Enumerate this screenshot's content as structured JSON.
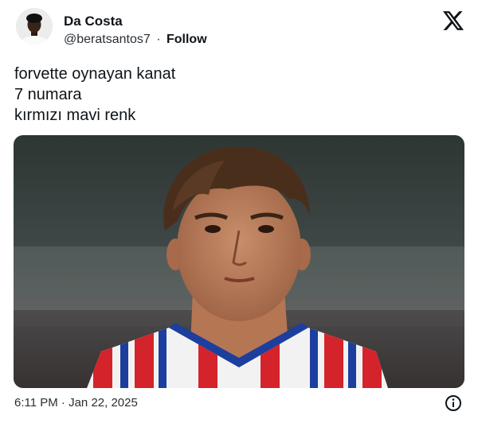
{
  "author": {
    "name": "Da Costa",
    "handle": "@beratsantos7",
    "separator": "·",
    "follow_label": "Follow"
  },
  "tweet": {
    "lines": [
      "forvette oynayan kanat",
      "7 numara",
      "kırmızı mavi renk"
    ]
  },
  "footer": {
    "time": "6:11 PM",
    "separator": "·",
    "date": "Jan 22, 2025"
  },
  "icons": {
    "brand": "x-logo-icon",
    "info": "info-icon"
  },
  "colors": {
    "text": "#0f1419",
    "secondary": "#2a2f34",
    "jersey_red": "#d4232a",
    "jersey_blue": "#1c3f9e"
  }
}
